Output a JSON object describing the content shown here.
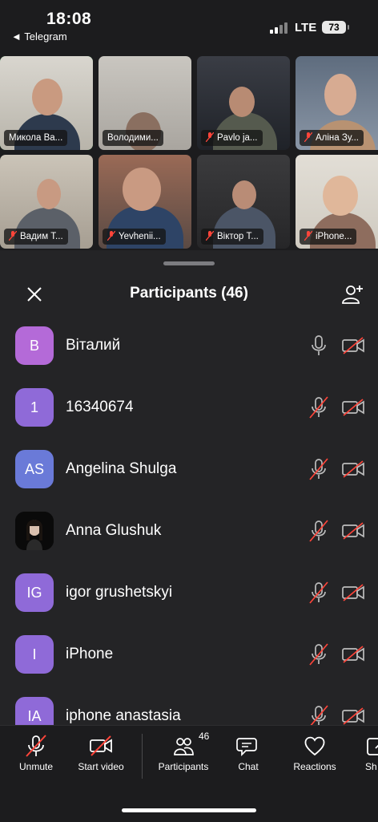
{
  "status_bar": {
    "time": "18:08",
    "back_app": "◄ Telegram",
    "network": "LTE",
    "battery": "73"
  },
  "video_tiles": [
    {
      "name": "Микола Ва...",
      "muted": false,
      "active": true
    },
    {
      "name": "Володими...",
      "muted": false,
      "active": false
    },
    {
      "name": "Pavlo ja...",
      "muted": true,
      "active": false
    },
    {
      "name": "Аліна Зу...",
      "muted": true,
      "active": false
    },
    {
      "name": "Вадим Т...",
      "muted": true,
      "active": false
    },
    {
      "name": "Yevhenii...",
      "muted": true,
      "active": false
    },
    {
      "name": "Віктор Т...",
      "muted": true,
      "active": false
    },
    {
      "name": "iPhone...",
      "muted": true,
      "active": false
    }
  ],
  "sheet": {
    "title": "Participants (46)"
  },
  "participants": [
    {
      "initials": "В",
      "name": "Віталий",
      "color": "#b46ad8",
      "mic_muted": false,
      "video_off": true
    },
    {
      "initials": "1",
      "name": "16340674",
      "color": "#8f6ad8",
      "mic_muted": true,
      "video_off": true
    },
    {
      "initials": "AS",
      "name": "Angelina Shulga",
      "color": "#6a7ad8",
      "mic_muted": true,
      "video_off": true
    },
    {
      "initials": "",
      "name": "Anna Glushuk",
      "color": "#0d0d0d",
      "mic_muted": true,
      "video_off": true,
      "photo": true
    },
    {
      "initials": "IG",
      "name": "igor grushetskyi",
      "color": "#8f6ad8",
      "mic_muted": true,
      "video_off": true
    },
    {
      "initials": "I",
      "name": "iPhone",
      "color": "#8f6ad8",
      "mic_muted": true,
      "video_off": true
    },
    {
      "initials": "IA",
      "name": "iphone anastasia",
      "color": "#8f6ad8",
      "mic_muted": true,
      "video_off": true
    }
  ],
  "toolbar": {
    "unmute": "Unmute",
    "start_video": "Start video",
    "participants": "Participants",
    "participants_count": "46",
    "chat": "Chat",
    "reactions": "Reactions",
    "share": "Sh"
  },
  "colors": {
    "accent_green": "#30c95a",
    "muted_red": "#ff453a",
    "sheet_bg": "#242426"
  }
}
